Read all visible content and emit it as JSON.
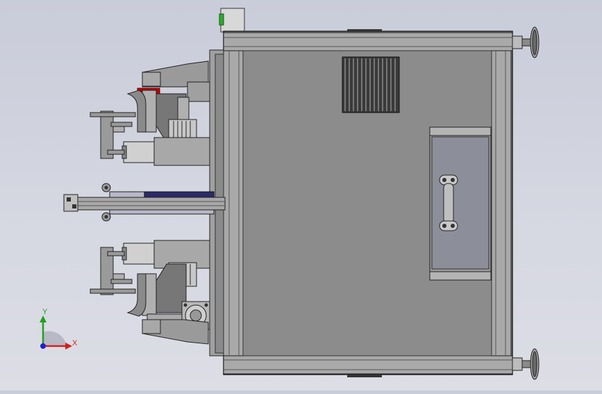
{
  "viewport": {
    "background_top": "#c9ccd9",
    "background_bottom": "#dcdde5"
  },
  "model": {
    "body_color": "#8f8f8f",
    "frame_color": "#a7a7a7",
    "panel_color": "#8a8c94",
    "accent_red": "#c00000",
    "accent_blue": "#2a2a6a",
    "indicator_green": "#2ea82e"
  },
  "triad": {
    "x_label": "X",
    "y_label": "Y",
    "x_color": "#d22020",
    "y_color": "#20a020",
    "z_color": "#2020d0"
  }
}
